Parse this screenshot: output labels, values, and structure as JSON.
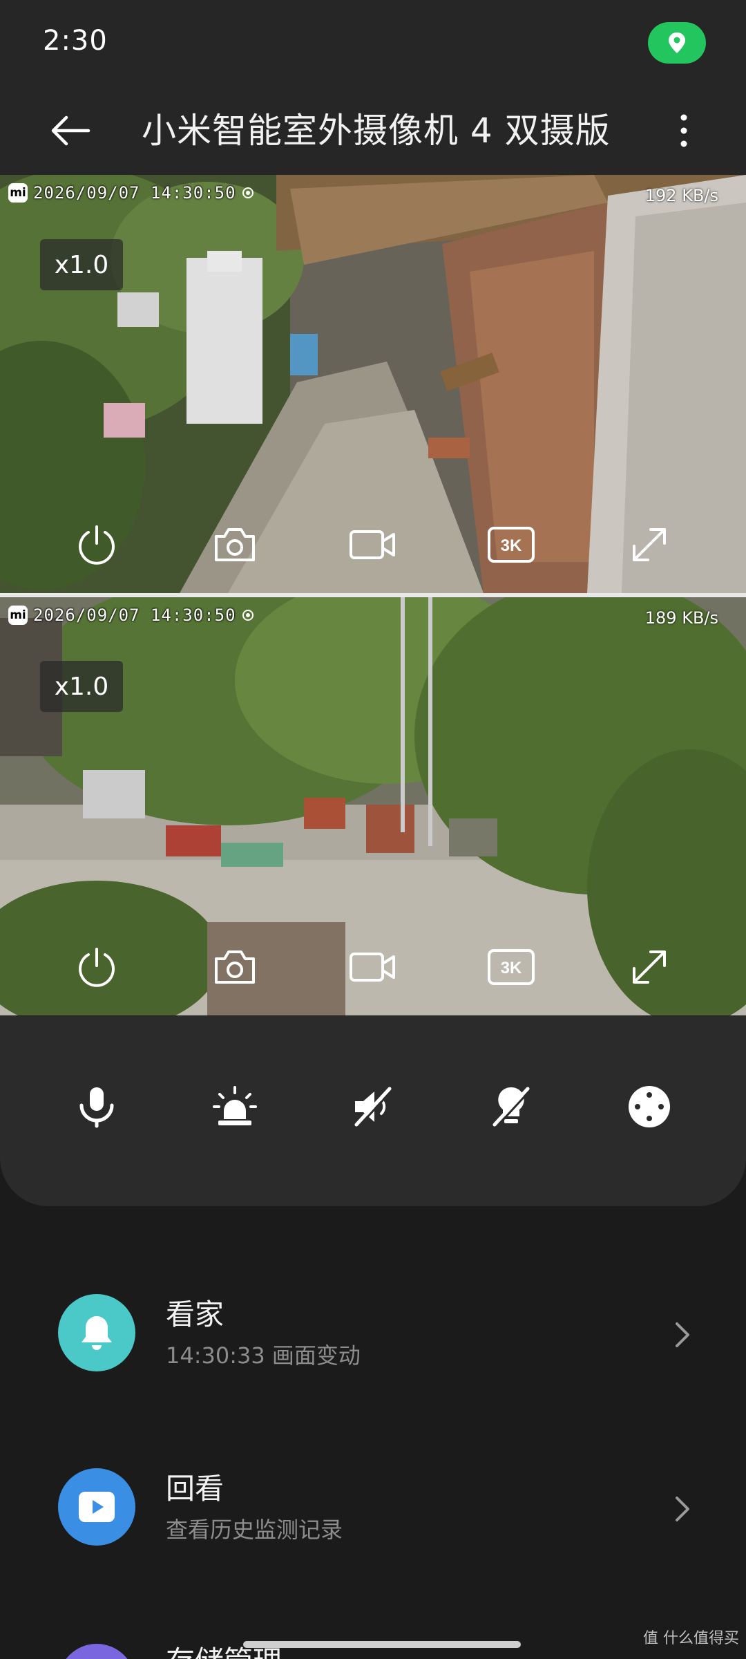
{
  "status_bar": {
    "time": "2:30"
  },
  "app_bar": {
    "title": "小米智能室外摄像机 4 双摄版"
  },
  "feeds": [
    {
      "timestamp": "2026/09/07 14:30:50",
      "rate": "192 KB/s",
      "zoom": "x1.0",
      "quality": "3K"
    },
    {
      "timestamp": "2026/09/07 14:30:50",
      "rate": "189 KB/s",
      "zoom": "x1.0",
      "quality": "3K"
    }
  ],
  "mi_logo": "mi",
  "icons": {
    "feed_controls": [
      "power-icon",
      "camera-snapshot-icon",
      "video-record-icon",
      "quality-3k-icon",
      "fullscreen-icon"
    ],
    "panel": [
      "microphone-icon",
      "alarm-light-icon",
      "mute-icon",
      "light-off-icon",
      "ptz-control-icon"
    ]
  },
  "list": [
    {
      "title": "看家",
      "subtitle": "14:30:33 画面变动",
      "icon": "bell-icon",
      "color": "#4bc8c8"
    },
    {
      "title": "回看",
      "subtitle": "查看历史监测记录",
      "icon": "play-icon",
      "color": "#3a8fe4"
    },
    {
      "title": "存储管理",
      "icon": "storage-icon",
      "color": "#7a67e0"
    }
  ],
  "watermark": "值 什么值得买"
}
